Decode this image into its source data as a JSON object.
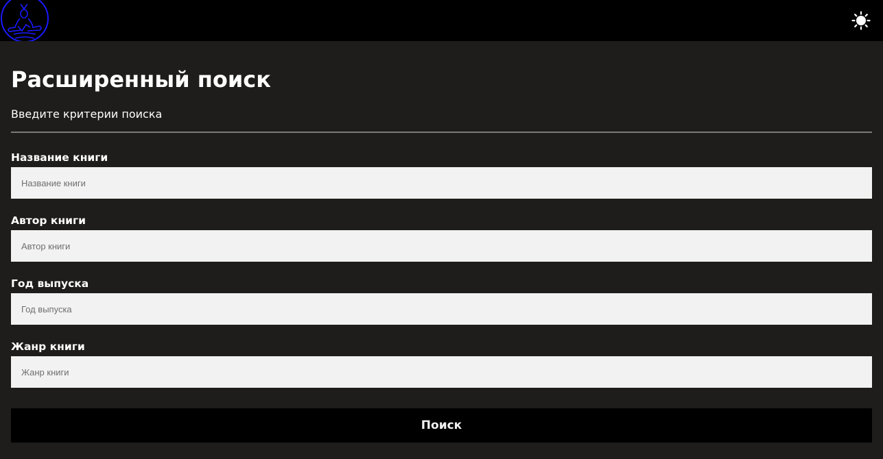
{
  "header": {
    "logo_icon": "reader-with-book-logo",
    "theme_toggle_icon": "sun-icon"
  },
  "page": {
    "title": "Расширенный поиск",
    "subtitle": "Введите критерии поиска"
  },
  "form": {
    "fields": [
      {
        "label": "Название книги",
        "placeholder": "Название книги",
        "value": ""
      },
      {
        "label": "Автор книги",
        "placeholder": "Автор книги",
        "value": ""
      },
      {
        "label": "Год выпуска",
        "placeholder": "Год выпуска",
        "value": ""
      },
      {
        "label": "Жанр книги",
        "placeholder": "Жанр книги",
        "value": ""
      }
    ],
    "submit_label": "Поиск"
  },
  "colors": {
    "header_bg": "#000000",
    "page_bg": "#1e1d1b",
    "input_bg": "#f2f2f2",
    "logo_stroke": "#1a1aff",
    "text": "#ffffff"
  }
}
